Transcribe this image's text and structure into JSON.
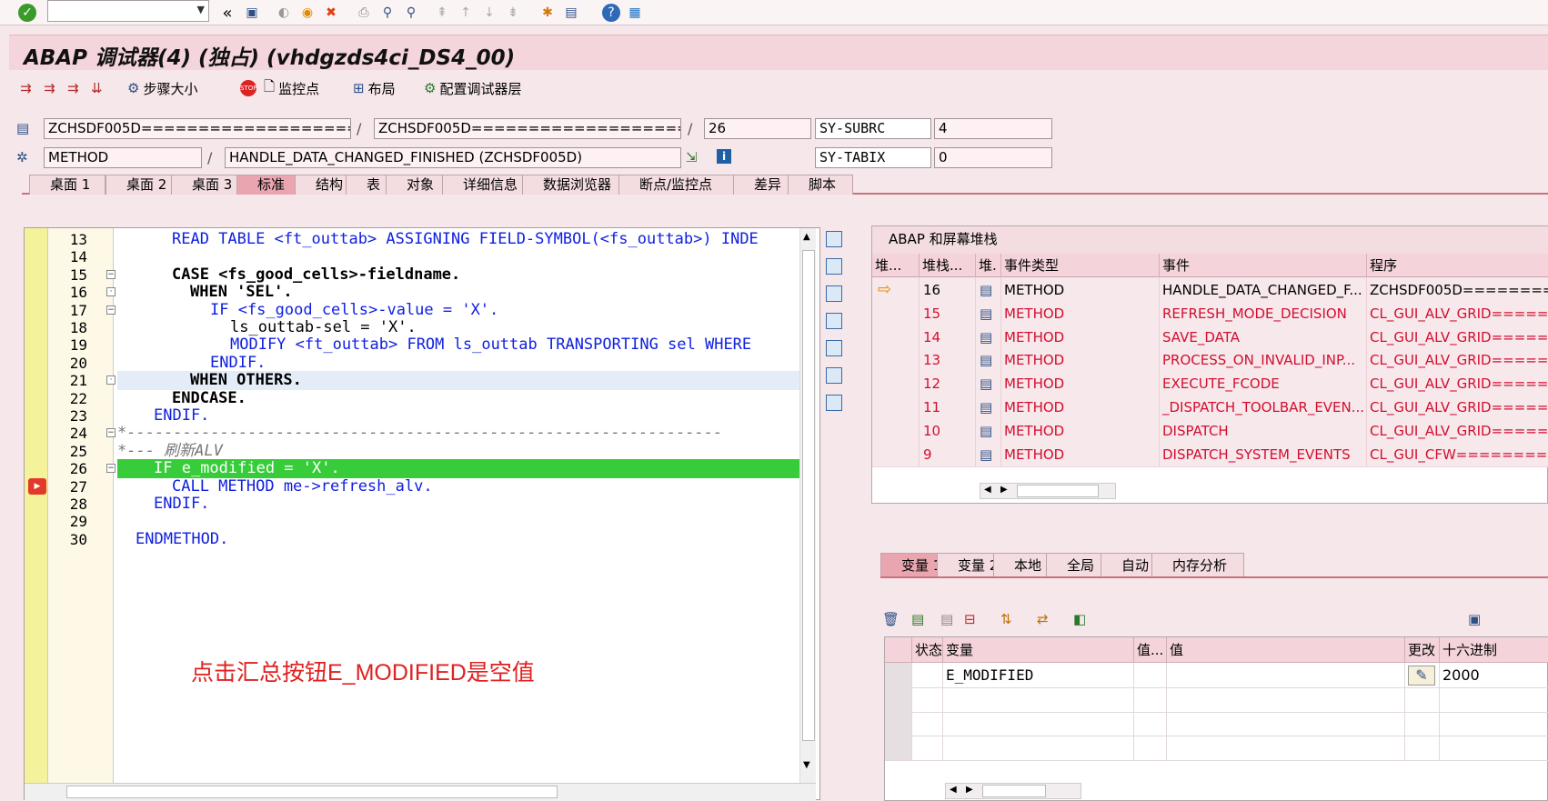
{
  "toolbar": {
    "command_field_value": "",
    "icons": [
      "check-icon",
      "collapse-icon",
      "save-icon",
      "back-icon",
      "exit-icon",
      "cancel-icon",
      "print-icon",
      "find-icon",
      "find-next-icon",
      "first-page-icon",
      "prev-page-icon",
      "next-page-icon",
      "last-page-icon",
      "new-session-icon",
      "shortcut-icon",
      "help-icon",
      "layout-icon"
    ]
  },
  "window": {
    "title": "ABAP 调试器(4) (独占) (vhdgzds4ci_DS4_00)"
  },
  "app_toolbar": {
    "step_size_label": "步骤大小",
    "watchpoint_label": "监控点",
    "layout_label": "布局",
    "config_layers_label": "配置调试器层"
  },
  "header": {
    "program_field": "ZCHSDF005D===================",
    "include_field": "ZCHSDF005D===================",
    "line_field": "26",
    "sysfield1_label": "SY-SUBRC",
    "sysfield1_value": "4",
    "type_field": "METHOD",
    "event_field": "HANDLE_DATA_CHANGED_FINISHED (ZCHSDF005D)",
    "sysfield2_label": "SY-TABIX",
    "sysfield2_value": "0"
  },
  "main_tabs": [
    {
      "label": "桌面 1"
    },
    {
      "label": "桌面 2"
    },
    {
      "label": "桌面 3"
    },
    {
      "label": "标准"
    },
    {
      "label": "结构"
    },
    {
      "label": "表"
    },
    {
      "label": "对象"
    },
    {
      "label": "详细信息"
    },
    {
      "label": "数据浏览器"
    },
    {
      "label": "断点/监控点"
    },
    {
      "label": "差异"
    },
    {
      "label": "脚本"
    }
  ],
  "code": {
    "lines": [
      {
        "num": "13",
        "text": "READ TABLE <ft_outtab> ASSIGNING FIELD-SYMBOL(<fs_outtab>) INDE"
      },
      {
        "num": "14",
        "text": ""
      },
      {
        "num": "15",
        "text": "CASE <fs_good_cells>-fieldname."
      },
      {
        "num": "16",
        "text": "WHEN 'SEL'."
      },
      {
        "num": "17",
        "text": "IF <fs_good_cells>-value = 'X'."
      },
      {
        "num": "18",
        "text": "ls_outtab-sel = 'X'."
      },
      {
        "num": "19",
        "text": "MODIFY <ft_outtab> FROM ls_outtab TRANSPORTING sel WHERE"
      },
      {
        "num": "20",
        "text": "ENDIF."
      },
      {
        "num": "21",
        "text": "WHEN OTHERS."
      },
      {
        "num": "22",
        "text": "ENDCASE."
      },
      {
        "num": "23",
        "text": "ENDIF."
      },
      {
        "num": "24",
        "text": "*----------------------------------------------------------------"
      },
      {
        "num": "25",
        "text": "*--- 刷新ALV"
      },
      {
        "num": "26",
        "text": "IF e_modified = 'X'."
      },
      {
        "num": "27",
        "text": "CALL METHOD me->refresh_alv."
      },
      {
        "num": "28",
        "text": "ENDIF."
      },
      {
        "num": "29",
        "text": ""
      },
      {
        "num": "30",
        "text": "ENDMETHOD."
      }
    ],
    "current_line": "26",
    "annotation": "点击汇总按钮E_MODIFIED是空值"
  },
  "stack": {
    "title": "ABAP 和屏幕堆栈",
    "columns": [
      "堆...",
      "堆栈...",
      "堆.",
      "事件类型",
      "事件",
      "程序"
    ],
    "rows": [
      {
        "level": "16",
        "type": "METHOD",
        "event": "HANDLE_DATA_CHANGED_F...",
        "program": "ZCHSDF005D=========",
        "current": true
      },
      {
        "level": "15",
        "type": "METHOD",
        "event": "REFRESH_MODE_DECISION",
        "program": "CL_GUI_ALV_GRID=====",
        "current": false
      },
      {
        "level": "14",
        "type": "METHOD",
        "event": "SAVE_DATA",
        "program": "CL_GUI_ALV_GRID=====",
        "current": false
      },
      {
        "level": "13",
        "type": "METHOD",
        "event": "PROCESS_ON_INVALID_INP...",
        "program": "CL_GUI_ALV_GRID=====",
        "current": false
      },
      {
        "level": "12",
        "type": "METHOD",
        "event": "EXECUTE_FCODE",
        "program": "CL_GUI_ALV_GRID=====",
        "current": false
      },
      {
        "level": "11",
        "type": "METHOD",
        "event": "_DISPATCH_TOOLBAR_EVEN...",
        "program": "CL_GUI_ALV_GRID=====",
        "current": false
      },
      {
        "level": "10",
        "type": "METHOD",
        "event": "DISPATCH",
        "program": "CL_GUI_ALV_GRID=====",
        "current": false
      },
      {
        "level": "9",
        "type": "METHOD",
        "event": "DISPATCH_SYSTEM_EVENTS",
        "program": "CL_GUI_CFW=========",
        "current": false
      }
    ]
  },
  "var_tabs": [
    {
      "label": "变量 1"
    },
    {
      "label": "变量 2"
    },
    {
      "label": "本地"
    },
    {
      "label": "全局"
    },
    {
      "label": "自动"
    },
    {
      "label": "内存分析"
    }
  ],
  "variables": {
    "columns": [
      "状态",
      "变量",
      "值...",
      "值",
      "更改",
      "十六进制"
    ],
    "rows": [
      {
        "name": "E_MODIFIED",
        "value": "",
        "hex": "2000"
      },
      {
        "name": "",
        "value": "",
        "hex": ""
      },
      {
        "name": "",
        "value": "",
        "hex": ""
      },
      {
        "name": "",
        "value": "",
        "hex": ""
      }
    ]
  },
  "colors": {
    "highlight_line": "#37cc3a",
    "cursor_line": "#e4ecf8",
    "keyword": "#1020e0",
    "string": "#159a15",
    "red_text": "#d20f30"
  }
}
